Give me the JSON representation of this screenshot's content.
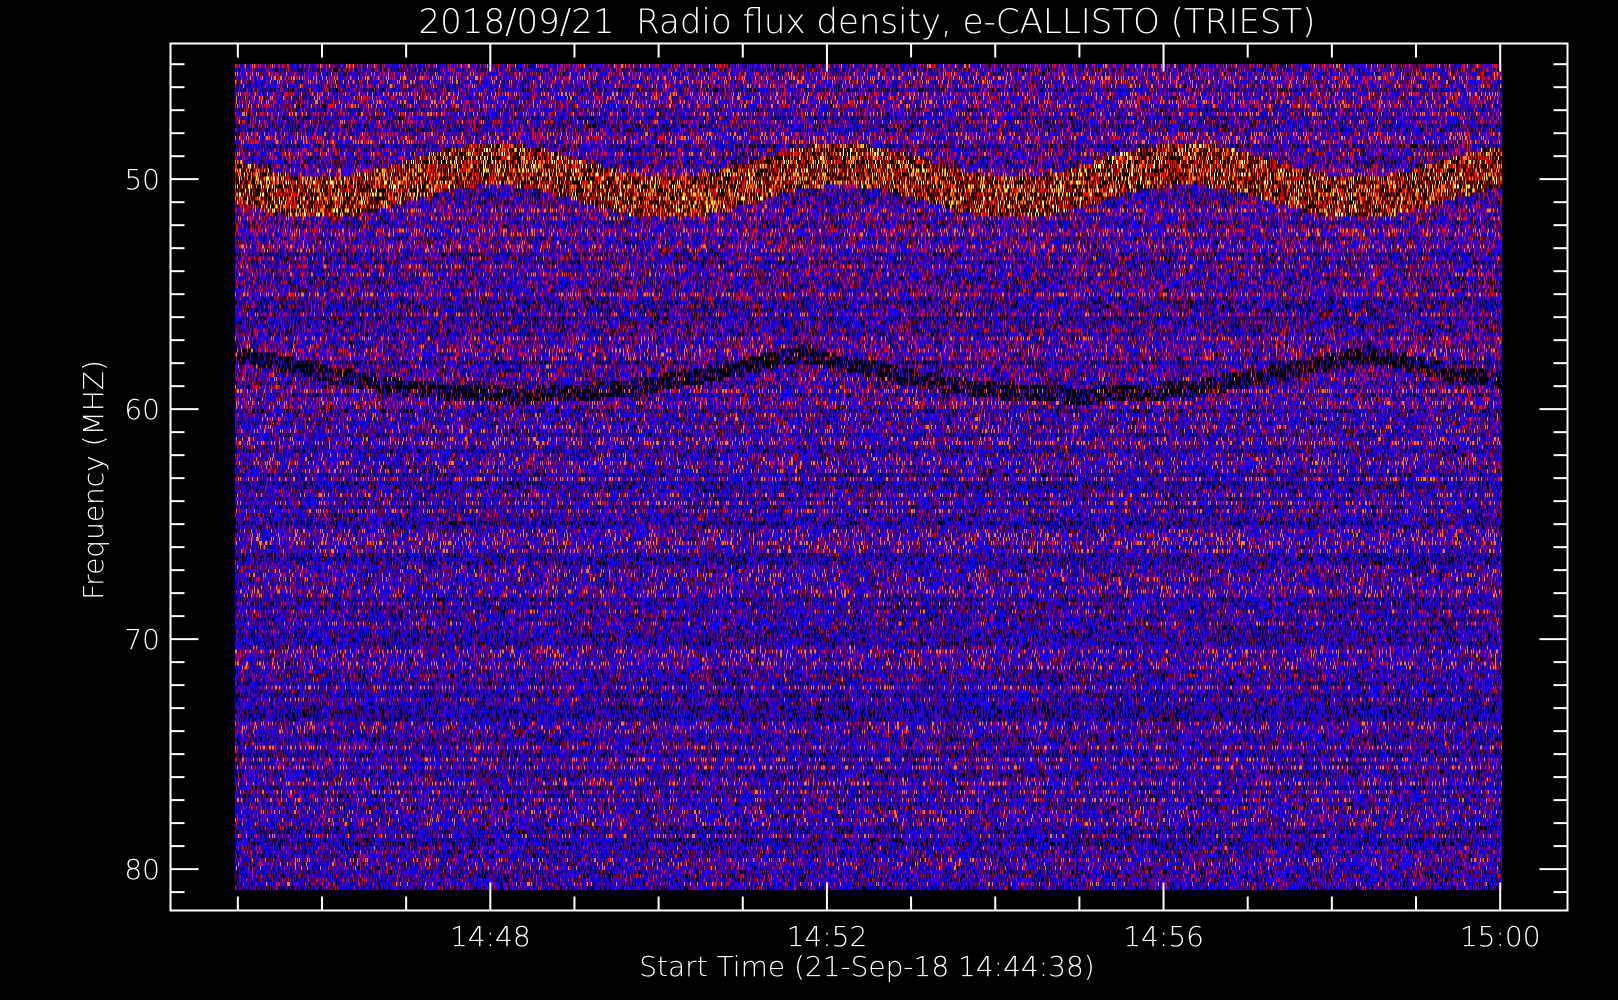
{
  "chart_data": {
    "type": "heatmap",
    "title": "2018/09/21  Radio flux density, e-CALLISTO (TRIEST)",
    "xlabel": "Start Time (21-Sep-18 14:44:38)",
    "ylabel": "Frequency (MHZ)",
    "x_ticks": [
      {
        "label": "14:48",
        "minutes": 48
      },
      {
        "label": "14:52",
        "minutes": 52
      },
      {
        "label": "14:56",
        "minutes": 56
      },
      {
        "label": "15:00",
        "minutes": 60
      }
    ],
    "x_minor_step_minutes": 1,
    "x_data_range_minutes": [
      44.63,
      60
    ],
    "xlim_minutes": [
      44.2,
      60.8
    ],
    "y_ticks": [
      50,
      60,
      70,
      80
    ],
    "y_minor_step": 1,
    "y_data_range": [
      45,
      80.9
    ],
    "ylim": [
      44.1,
      81.8
    ],
    "y_inverted": true,
    "colormap": [
      "#000000",
      "#0000ff",
      "#4a00c8",
      "#800000",
      "#ff0000",
      "#ff8000",
      "#ffff60"
    ],
    "features": [
      {
        "name": "bright band with dark arcs",
        "freq_mhz": 50
      },
      {
        "name": "faint dark arcs",
        "freq_mhz": 58
      }
    ]
  }
}
